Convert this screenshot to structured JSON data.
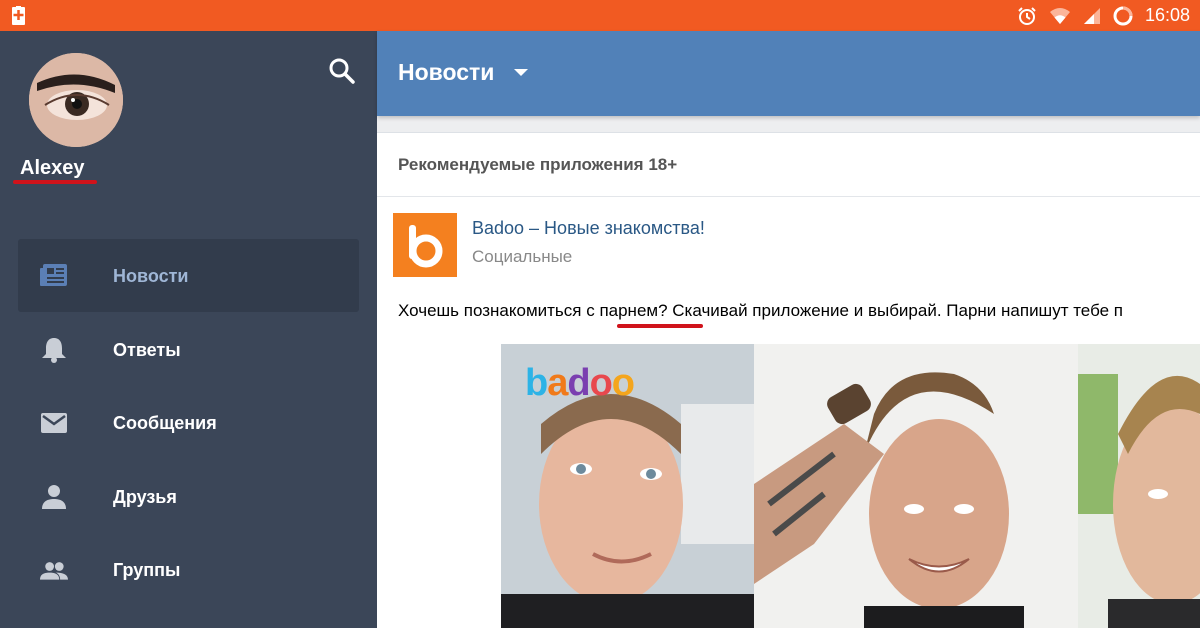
{
  "status_bar": {
    "time": "16:08",
    "icons": [
      "battery-charging-icon",
      "alarm-icon",
      "wifi-icon",
      "signal-icon",
      "battery-icon"
    ],
    "color": "#f15a22"
  },
  "sidebar": {
    "user_name": "Alexey",
    "search_icon": "search-icon",
    "items": [
      {
        "label": "Новости",
        "icon": "newspaper-icon",
        "active": true
      },
      {
        "label": "Ответы",
        "icon": "bell-icon",
        "active": false
      },
      {
        "label": "Сообщения",
        "icon": "envelope-icon",
        "active": false
      },
      {
        "label": "Друзья",
        "icon": "person-icon",
        "active": false
      },
      {
        "label": "Группы",
        "icon": "group-icon",
        "active": false
      }
    ],
    "background": "#3b4658"
  },
  "header": {
    "title": "Новости",
    "color": "#5181b8"
  },
  "feed": {
    "section_title": "Рекомендуемые приложения 18+",
    "app": {
      "name": "Badoo – Новые знакомства!",
      "category": "Социальные"
    },
    "post_text_before": "Хочешь познакомиться с ",
    "post_text_highlight": "парнем?",
    "post_text_after": " Скачивай приложение и выбирай. Парни напишут тебе п",
    "photo_logo": "badoo"
  }
}
